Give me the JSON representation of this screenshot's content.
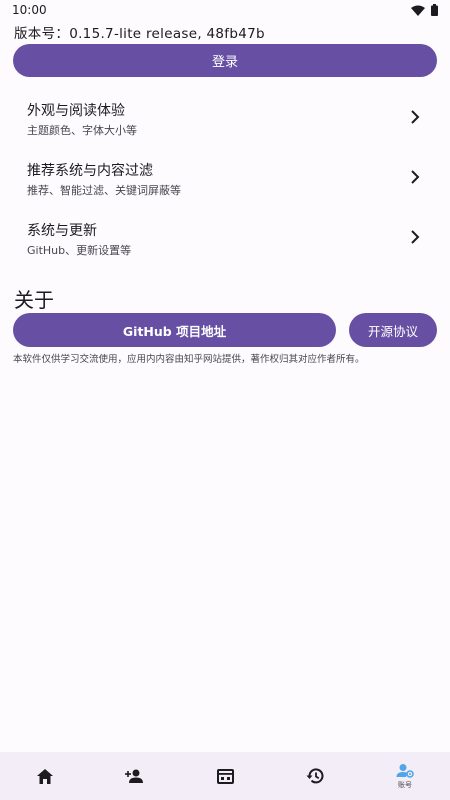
{
  "status_bar": {
    "time": "10:00"
  },
  "version_text": "版本号：0.15.7-lite release, 48fb47b",
  "login_button": "登录",
  "menu": [
    {
      "title": "外观与阅读体验",
      "subtitle": "主题颜色、字体大小等"
    },
    {
      "title": "推荐系统与内容过滤",
      "subtitle": "推荐、智能过滤、关键词屏蔽等"
    },
    {
      "title": "系统与更新",
      "subtitle": "GitHub、更新设置等"
    }
  ],
  "about": {
    "title": "关于",
    "github_button": "GitHub 项目地址",
    "license_button": "开源协议",
    "disclaimer": "本软件仅供学习交流使用，应用内内容由知乎网站提供，著作权归其对应作者所有。"
  },
  "bottom_nav": {
    "items": [
      {
        "icon": "home-icon",
        "label": ""
      },
      {
        "icon": "person-add-icon",
        "label": ""
      },
      {
        "icon": "calendar-view-icon",
        "label": ""
      },
      {
        "icon": "history-icon",
        "label": ""
      },
      {
        "icon": "account-settings-icon",
        "label": "账号"
      }
    ]
  },
  "colors": {
    "primary": "#6750a4",
    "active_nav": "#4fa6e8"
  }
}
